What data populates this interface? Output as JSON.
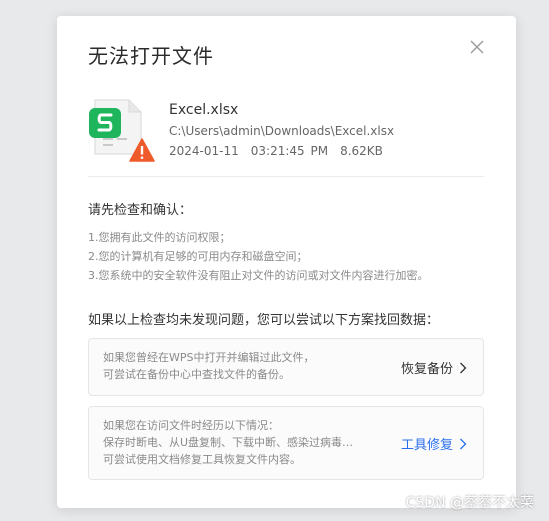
{
  "dialog": {
    "title": "无法打开文件",
    "close_icon": "close-icon"
  },
  "file": {
    "icon": "spreadsheet-file-icon",
    "warning_icon": "warning-icon",
    "name": "Excel.xlsx",
    "path": "C:\\Users\\admin\\Downloads\\Excel.xlsx",
    "date": "2024-01-11",
    "time": "03:21:45 PM",
    "size": "8.62KB"
  },
  "confirm": {
    "title": "请先检查和确认：",
    "items": [
      "1.您拥有此文件的访问权限；",
      "2.您的计算机有足够的可用内存和磁盘空间；",
      "3.您系统中的安全软件没有阻止对文件的访问或对文件内容进行加密。"
    ]
  },
  "recovery": {
    "title": "如果以上检查均未发现问题，您可以尝试以下方案找回数据：",
    "backup": {
      "line1": "如果您曾经在WPS中打开并编辑过此文件，",
      "line2": "可尝试在备份中心中查找文件的备份。",
      "action": "恢复备份"
    },
    "repair": {
      "line1": "如果您在访问文件时经历以下情况：",
      "line2": "保存时断电、从U盘复制、下载中断、感染过病毒…",
      "line3": "可尝试使用文档修复工具恢复文件内容。",
      "action": "工具修复"
    }
  },
  "watermark": "CSDN @蔡蔡不太菜",
  "colors": {
    "wps_green": "#1fb55d",
    "warning_orange": "#ee5a2a",
    "link_blue": "#2a6ff0",
    "text_dark": "#333333"
  }
}
